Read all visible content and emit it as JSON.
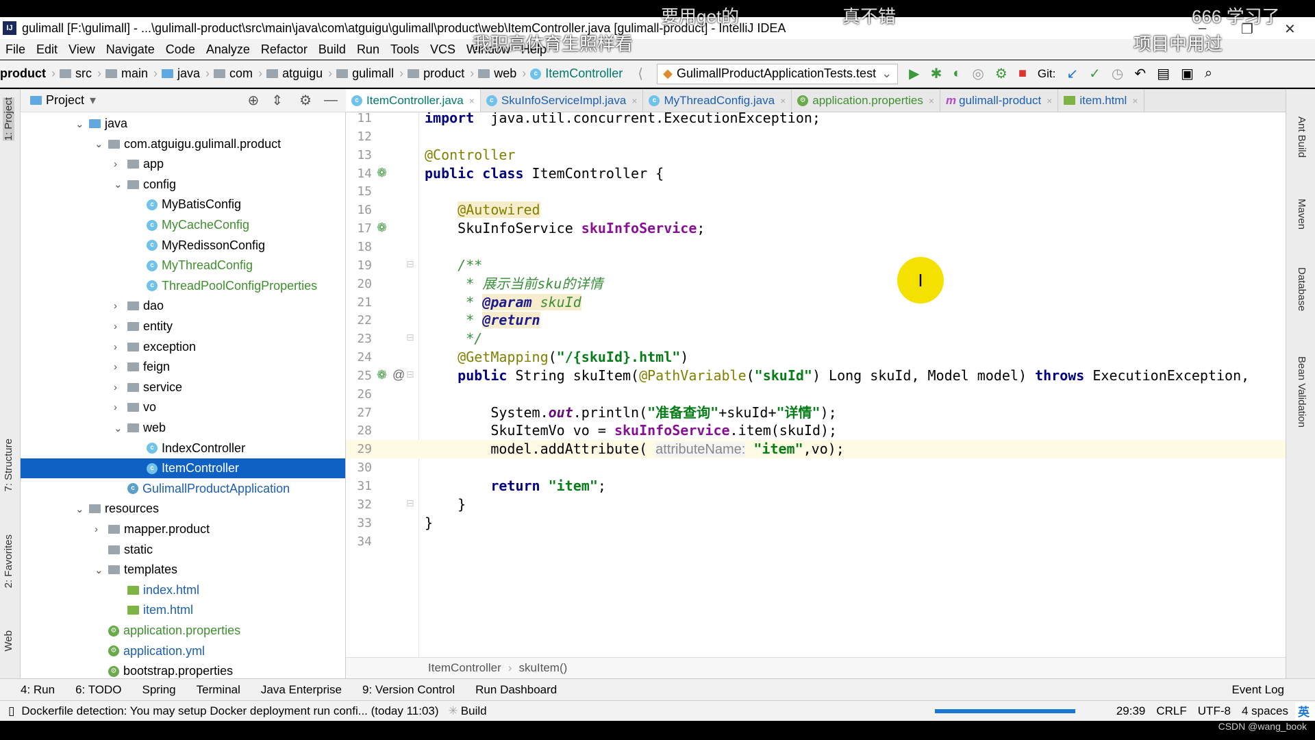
{
  "window": {
    "title": "gulimall [F:\\gulimall] - ...\\gulimall-product\\src\\main\\java\\com\\atguigu\\gulimall\\product\\web\\ItemController.java [gulimall-product] - IntelliJ IDEA",
    "logo": "IJ"
  },
  "menu": [
    "File",
    "Edit",
    "View",
    "Navigate",
    "Code",
    "Analyze",
    "Refactor",
    "Build",
    "Run",
    "Tools",
    "VCS",
    "Window",
    "Help"
  ],
  "nav": {
    "crumbs": [
      "product",
      "src",
      "main",
      "java",
      "com",
      "atguigu",
      "gulimall",
      "product",
      "web",
      "ItemController"
    ],
    "run_config": "GulimallProductApplicationTests.test",
    "git_label": "Git:"
  },
  "project_panel": {
    "title": "Project"
  },
  "left_strip": [
    "1: Project",
    "7: Structure",
    "2: Favorites",
    "Web"
  ],
  "tree": [
    {
      "label": "java",
      "depth": 0,
      "arrow": "down",
      "icon": "folder-blue"
    },
    {
      "label": "com.atguigu.gulimall.product",
      "depth": 1,
      "arrow": "down",
      "icon": "folder"
    },
    {
      "label": "app",
      "depth": 2,
      "arrow": "right",
      "icon": "folder"
    },
    {
      "label": "config",
      "depth": 2,
      "arrow": "down",
      "icon": "folder"
    },
    {
      "label": "MyBatisConfig",
      "depth": 3,
      "arrow": "",
      "icon": "class"
    },
    {
      "label": "MyCacheConfig",
      "depth": 3,
      "arrow": "",
      "icon": "class",
      "color": "#3f8f2f"
    },
    {
      "label": "MyRedissonConfig",
      "depth": 3,
      "arrow": "",
      "icon": "class"
    },
    {
      "label": "MyThreadConfig",
      "depth": 3,
      "arrow": "",
      "icon": "class",
      "color": "#3f8f2f"
    },
    {
      "label": "ThreadPoolConfigProperties",
      "depth": 3,
      "arrow": "",
      "icon": "class",
      "color": "#3f8f2f"
    },
    {
      "label": "dao",
      "depth": 2,
      "arrow": "right",
      "icon": "folder"
    },
    {
      "label": "entity",
      "depth": 2,
      "arrow": "right",
      "icon": "folder"
    },
    {
      "label": "exception",
      "depth": 2,
      "arrow": "right",
      "icon": "folder"
    },
    {
      "label": "feign",
      "depth": 2,
      "arrow": "right",
      "icon": "folder"
    },
    {
      "label": "service",
      "depth": 2,
      "arrow": "right",
      "icon": "folder"
    },
    {
      "label": "vo",
      "depth": 2,
      "arrow": "right",
      "icon": "folder"
    },
    {
      "label": "web",
      "depth": 2,
      "arrow": "down",
      "icon": "folder"
    },
    {
      "label": "IndexController",
      "depth": 3,
      "arrow": "",
      "icon": "class"
    },
    {
      "label": "ItemController",
      "depth": 3,
      "arrow": "",
      "icon": "class",
      "selected": true
    },
    {
      "label": "GulimallProductApplication",
      "depth": 2,
      "arrow": "",
      "icon": "spring-class",
      "color": "#1d5fb0"
    },
    {
      "label": "resources",
      "depth": 0,
      "arrow": "down",
      "icon": "folder"
    },
    {
      "label": "mapper.product",
      "depth": 1,
      "arrow": "right",
      "icon": "folder"
    },
    {
      "label": "static",
      "depth": 1,
      "arrow": "",
      "icon": "folder"
    },
    {
      "label": "templates",
      "depth": 1,
      "arrow": "down",
      "icon": "folder"
    },
    {
      "label": "index.html",
      "depth": 2,
      "arrow": "",
      "icon": "html",
      "color": "#1d5fb0"
    },
    {
      "label": "item.html",
      "depth": 2,
      "arrow": "",
      "icon": "html",
      "color": "#1d5fb0"
    },
    {
      "label": "application.properties",
      "depth": 1,
      "arrow": "",
      "icon": "spring-config",
      "color": "#3f8f2f"
    },
    {
      "label": "application.yml",
      "depth": 1,
      "arrow": "",
      "icon": "spring-config",
      "color": "#1d5fb0"
    },
    {
      "label": "bootstrap.properties",
      "depth": 1,
      "arrow": "",
      "icon": "spring-config"
    }
  ],
  "tabs": [
    {
      "label": "ItemController.java",
      "icon": "class",
      "active": true
    },
    {
      "label": "SkuInfoServiceImpl.java",
      "icon": "class"
    },
    {
      "label": "MyThreadConfig.java",
      "icon": "class"
    },
    {
      "label": "application.properties",
      "icon": "spring-config",
      "color": "#3f8f2f"
    },
    {
      "label": "gulimall-product",
      "icon": "maven"
    },
    {
      "label": "item.html",
      "icon": "html"
    }
  ],
  "editor": {
    "current_line": 29,
    "lines": [
      {
        "n": 11,
        "t": [
          [
            "kw",
            "import"
          ],
          [
            "",
            "  java.util.concurrent.ExecutionException;"
          ]
        ]
      },
      {
        "n": 12,
        "t": []
      },
      {
        "n": 13,
        "t": [
          [
            "ann",
            "@Controller"
          ]
        ]
      },
      {
        "n": 14,
        "t": [
          [
            "kw",
            "public class"
          ],
          [
            "",
            " ItemController {"
          ]
        ]
      },
      {
        "n": 15,
        "t": []
      },
      {
        "n": 16,
        "t": [
          [
            "",
            "    "
          ],
          [
            "ann hl",
            "@Autowired"
          ]
        ]
      },
      {
        "n": 17,
        "t": [
          [
            "",
            "    SkuInfoService "
          ],
          [
            "fld",
            "skuInfoService"
          ],
          [
            "",
            ";"
          ]
        ]
      },
      {
        "n": 18,
        "t": []
      },
      {
        "n": 19,
        "t": [
          [
            "cmt",
            "    /**"
          ]
        ]
      },
      {
        "n": 20,
        "t": [
          [
            "cmt",
            "     * 展示当前sku的详情"
          ]
        ]
      },
      {
        "n": 21,
        "t": [
          [
            "cmt",
            "     * "
          ],
          [
            "tag",
            "@param"
          ],
          [
            "cmt hl",
            " skuId"
          ]
        ]
      },
      {
        "n": 22,
        "t": [
          [
            "cmt",
            "     * "
          ],
          [
            "tag",
            "@return"
          ]
        ]
      },
      {
        "n": 23,
        "t": [
          [
            "cmt",
            "     */"
          ]
        ]
      },
      {
        "n": 24,
        "t": [
          [
            "",
            "    "
          ],
          [
            "ann",
            "@GetMapping"
          ],
          [
            "",
            "("
          ],
          [
            "str",
            "\"/{skuId}.html\""
          ],
          [
            "",
            ")"
          ]
        ]
      },
      {
        "n": 25,
        "t": [
          [
            "",
            "    "
          ],
          [
            "kw",
            "public"
          ],
          [
            "",
            " String skuItem("
          ],
          [
            "ann",
            "@PathVariable"
          ],
          [
            "",
            "("
          ],
          [
            "str",
            "\"skuId\""
          ],
          [
            "",
            ") Long skuId, Model model) "
          ],
          [
            "kw",
            "throws"
          ],
          [
            "",
            " ExecutionException,"
          ]
        ]
      },
      {
        "n": 26,
        "t": []
      },
      {
        "n": 27,
        "t": [
          [
            "",
            "        System."
          ],
          [
            "ital",
            "out"
          ],
          [
            "",
            ".println("
          ],
          [
            "str",
            "\"准备查询\""
          ],
          [
            "",
            "+skuId+"
          ],
          [
            "str",
            "\"详情\""
          ],
          [
            "",
            ");"
          ]
        ]
      },
      {
        "n": 28,
        "t": [
          [
            "",
            "        SkuItemVo vo = "
          ],
          [
            "fld",
            "skuInfoService"
          ],
          [
            "",
            ".item(skuId);"
          ]
        ]
      },
      {
        "n": 29,
        "t": [
          [
            "",
            "        model.addAttribute( "
          ],
          [
            "hint",
            "attributeName:"
          ],
          [
            "",
            " "
          ],
          [
            "str",
            "\"item\""
          ],
          [
            "",
            ",vo);"
          ]
        ]
      },
      {
        "n": 30,
        "t": []
      },
      {
        "n": 31,
        "t": [
          [
            "",
            "        "
          ],
          [
            "kw",
            "return"
          ],
          [
            "",
            " "
          ],
          [
            "str",
            "\"item\""
          ],
          [
            "",
            ";"
          ]
        ]
      },
      {
        "n": 32,
        "t": [
          [
            "",
            "    }"
          ]
        ]
      },
      {
        "n": 33,
        "t": [
          [
            "",
            "}"
          ]
        ]
      },
      {
        "n": 34,
        "t": []
      }
    ]
  },
  "editor_breadcrumb": [
    "ItemController",
    "skuItem()"
  ],
  "right_strip": [
    "Ant Build",
    "Maven",
    "Database",
    "Bean Validation"
  ],
  "tool_windows": [
    "4: Run",
    "6: TODO",
    "Spring",
    "Terminal",
    "Java Enterprise",
    "9: Version Control",
    "Run Dashboard"
  ],
  "event_log": "Event Log",
  "status": {
    "message": "Dockerfile detection: You may setup Docker deployment run confi... (today 11:03)",
    "build": "Build",
    "position": "29:39",
    "line_sep": "CRLF",
    "encoding": "UTF-8",
    "indent": "4 spaces",
    "ime": "英"
  },
  "overlay": {
    "danmaku": [
      "要用get的",
      "真不错",
      "666 学习了",
      "我职高体育生照样看",
      "项目中用过"
    ],
    "watermark": "CSDN @wang_book"
  },
  "colors": {
    "selection": "#0f62c4",
    "current_line": "#fffae3",
    "keyword": "#000080",
    "string": "#067d17"
  }
}
